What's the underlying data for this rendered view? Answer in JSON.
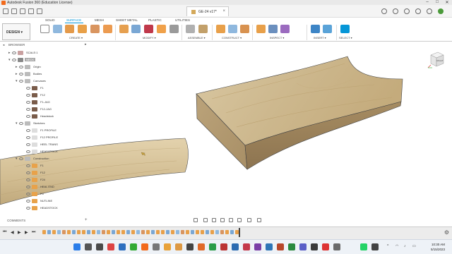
{
  "window": {
    "title": "Autodesk Fusion 360 (Education License)",
    "minimize": "–",
    "maximize": "□",
    "close": "✕"
  },
  "document": {
    "tab_label": "GE-24 v17*",
    "close_glyph": "×"
  },
  "ribbon": {
    "workspace_label": "DESIGN ▾",
    "tabs": [
      "SOLID",
      "SURFACE",
      "MESH",
      "SHEET METAL",
      "PLASTIC",
      "UTILITIES"
    ],
    "active_tab": "SURFACE",
    "groups": [
      "CREATE ▾",
      "MODIFY ▾",
      "ASSEMBLE ▾",
      "CONSTRUCT ▾",
      "INSPECT ▾",
      "INSERT ▾",
      "SELECT ▾"
    ]
  },
  "browser": {
    "title": "BROWSER",
    "items": [
      {
        "label": "SCALE:1",
        "highlight": false
      },
      {
        "label": "NECK",
        "highlight": true
      },
      {
        "label": "Origin",
        "highlight": false
      },
      {
        "label": "Bodies",
        "highlight": false
      },
      {
        "label": "Canvases",
        "highlight": false
      },
      {
        "label": "F1",
        "highlight": false
      },
      {
        "label": "F12",
        "highlight": false
      },
      {
        "label": "F1-JAG",
        "highlight": false
      },
      {
        "label": "F12-JAG",
        "highlight": false
      },
      {
        "label": "Headstock",
        "highlight": false
      },
      {
        "label": "Sketches",
        "highlight": false
      },
      {
        "label": "F1 PROFILE",
        "highlight": false
      },
      {
        "label": "F12 PROFILE",
        "highlight": false
      },
      {
        "label": "HEEL TRANS",
        "highlight": false
      },
      {
        "label": "HEADSTOCK",
        "highlight": false
      },
      {
        "label": "Construction",
        "highlight": false
      },
      {
        "label": "F1",
        "highlight": false
      },
      {
        "label": "F12",
        "highlight": false
      },
      {
        "label": "F24",
        "highlight": false
      },
      {
        "label": "HEAL END",
        "highlight": false
      },
      {
        "label": "F0",
        "highlight": false
      },
      {
        "label": "NUTLINE",
        "highlight": false
      },
      {
        "label": "HEADSTOCK",
        "highlight": false
      }
    ]
  },
  "comments": {
    "label": "COMMENTS",
    "add_glyph": "+"
  },
  "viewcube": {
    "face_label": "RIGHT"
  },
  "timeline": {
    "controls": [
      "⏮",
      "◀",
      "▶",
      "▶",
      "⏭"
    ],
    "gear_glyph": "⚙"
  },
  "taskbar": {
    "time": "10:30 AM",
    "date": "5/15/2023"
  },
  "colors": {
    "accent": "#0696d7",
    "wood_light": "#d8c6a0",
    "wood_dark": "#a8926a",
    "fusion_orange": "#f26a1b"
  }
}
